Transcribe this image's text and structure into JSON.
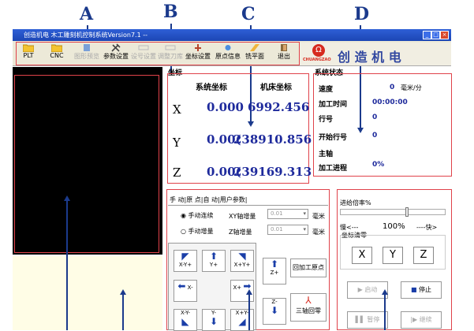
{
  "annotations": [
    "A",
    "B",
    "C",
    "D"
  ],
  "window": {
    "title": "创造机电 木工雕刻机控制系统Version7.1 --"
  },
  "toolbar": {
    "items": [
      {
        "label": "PLT",
        "icon": "folder-icon",
        "enabled": true
      },
      {
        "label": "CNC",
        "icon": "folder-icon",
        "enabled": true
      },
      {
        "label": "图形预览",
        "icon": "preview-icon",
        "enabled": false
      },
      {
        "label": "参数设置",
        "icon": "tools-icon",
        "enabled": true
      },
      {
        "label": "设号设置",
        "icon": "reset-icon",
        "enabled": false
      },
      {
        "label": "调整刀库",
        "icon": "tool-library-icon",
        "enabled": false
      },
      {
        "label": "坐标设置",
        "icon": "axis-icon",
        "enabled": true
      },
      {
        "label": "原点信息",
        "icon": "origin-icon",
        "enabled": true
      },
      {
        "label": "铣平面",
        "icon": "mill-icon",
        "enabled": true
      },
      {
        "label": "退出",
        "icon": "exit-icon",
        "enabled": true
      }
    ],
    "brand": {
      "logo": "CHUANGZAO",
      "name": "创 造 机 电"
    }
  },
  "coords": {
    "title": "坐标",
    "header_sys": "系统坐标",
    "header_mach": "机床坐标",
    "rows": [
      {
        "axis": "X",
        "sys": "0.000",
        "mach": "6992.456"
      },
      {
        "axis": "Y",
        "sys": "0.00(",
        "mach": "238910.856"
      },
      {
        "axis": "Z",
        "sys": "0.00(",
        "mach": "239169.313"
      }
    ]
  },
  "status": {
    "title": "系统状态",
    "speed_label": "速度",
    "speed_val": "0",
    "speed_unit": "毫米/分",
    "time_label": "加工时间",
    "time_val": "00:00:00",
    "line_label": "行号",
    "line_val": "0",
    "start_label": "开始行号",
    "start_val": "0",
    "spindle_label": "主轴",
    "progress_label": "加工进程",
    "progress_val": "0%"
  },
  "manual": {
    "tabs": "手 动|原 点|自 动|用户参数|",
    "mode_cont": "手动连续",
    "mode_step": "手动增量",
    "xy_inc_label": "XY轴增量",
    "xy_inc_val": "0.01",
    "xy_unit": "毫米",
    "z_inc_label": "Z轴增量",
    "z_inc_val": "0.01",
    "z_unit": "毫米",
    "jog": {
      "xmyp": "X-Y+",
      "yp": "Y+",
      "xpyp": "X+Y+",
      "xm": "X-",
      "xp": "X+",
      "xmym": "X-Y-",
      "ym": "Y-",
      "xpym": "X+Y-",
      "zp": "Z+",
      "zm": "Z-"
    },
    "back_origin": "回加工原点",
    "three_axis_home": "三轴回零"
  },
  "feed": {
    "title": "进给倍率%",
    "slow": "慢<---",
    "percent": "100%",
    "fast": "----快>",
    "zero_title": "坐标清零",
    "x": "X",
    "y": "Y",
    "z": "Z",
    "start": "启动",
    "stop": "停止",
    "pause": "暂停",
    "resume": "继续"
  }
}
